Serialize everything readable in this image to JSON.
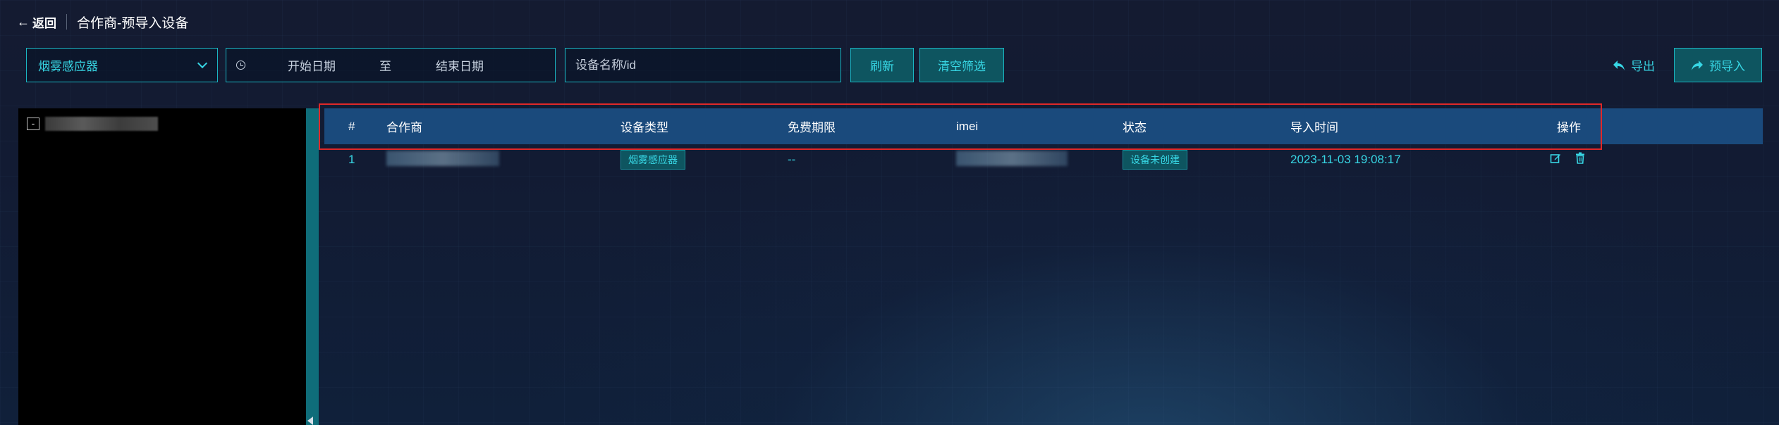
{
  "header": {
    "back_label": "返回",
    "title": "合作商-预导入设备"
  },
  "toolbar": {
    "device_type_selected": "烟雾感应器",
    "date_start_placeholder": "开始日期",
    "date_separator": "至",
    "date_end_placeholder": "结束日期",
    "search_placeholder": "设备名称/id",
    "refresh_label": "刷新",
    "clear_filter_label": "清空筛选",
    "export_label": "导出",
    "preimport_label": "预导入"
  },
  "tree": {
    "toggle_symbol": "-"
  },
  "table": {
    "columns": [
      "#",
      "合作商",
      "设备类型",
      "免费期限",
      "imei",
      "状态",
      "导入时间",
      "操作"
    ],
    "rows": [
      {
        "index": "1",
        "device_type": "烟雾感应器",
        "free_period": "--",
        "status": "设备未创建",
        "import_time": "2023-11-03 19:08:17"
      }
    ]
  },
  "colors": {
    "accent": "#37d6e4",
    "border": "#1ab6c3",
    "header_bg": "#1a4a7c",
    "highlight": "#e02828"
  }
}
